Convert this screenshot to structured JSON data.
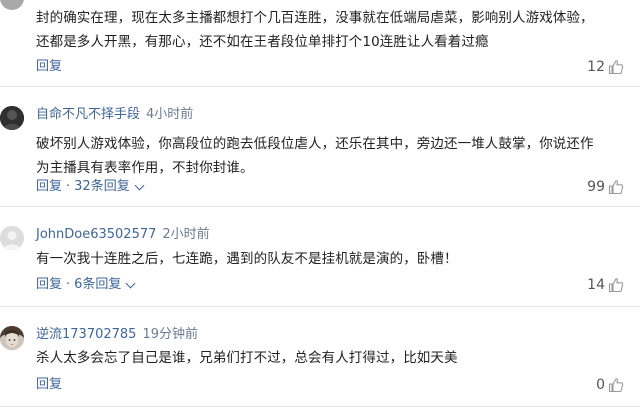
{
  "comments": [
    {
      "body": "封的确实在理，现在太多主播都想打个几百连胜，没事就在低端局虐菜，影响别人游戏体验，还都是多人开黑，有那心，还不如在王者段位单排打个10连胜让人看着过瘾",
      "reply_label": "回复",
      "likes": "12"
    },
    {
      "username": "自命不凡不择手段",
      "time": "4小时前",
      "body": "破坏别人游戏体验，你高段位的跑去低段位虐人，还乐在其中，旁边还一堆人鼓掌，你说还作为主播具有表率作用，不封你封谁。",
      "reply_label": "回复",
      "thread_label": "32条回复",
      "likes": "99"
    },
    {
      "username": "JohnDoe63502577",
      "time": "2小时前",
      "body": "有一次我十连胜之后，七连跪，遇到的队友不是挂机就是演的，卧槽！",
      "reply_label": "回复",
      "thread_label": "6条回复",
      "likes": "14"
    },
    {
      "username": "逆流173702785",
      "time": "19分钟前",
      "body": "杀人太多会忘了自己是谁，兄弟们打不过，总会有人打得过，比如天美",
      "reply_label": "回复",
      "likes": "0"
    }
  ],
  "colors": {
    "link": "#406599",
    "time": "#6c7b93",
    "text": "#222222",
    "divider": "#e6e6e6"
  },
  "icons": {
    "like": "thumbs-up-icon",
    "chevron": "chevron-down-icon"
  }
}
